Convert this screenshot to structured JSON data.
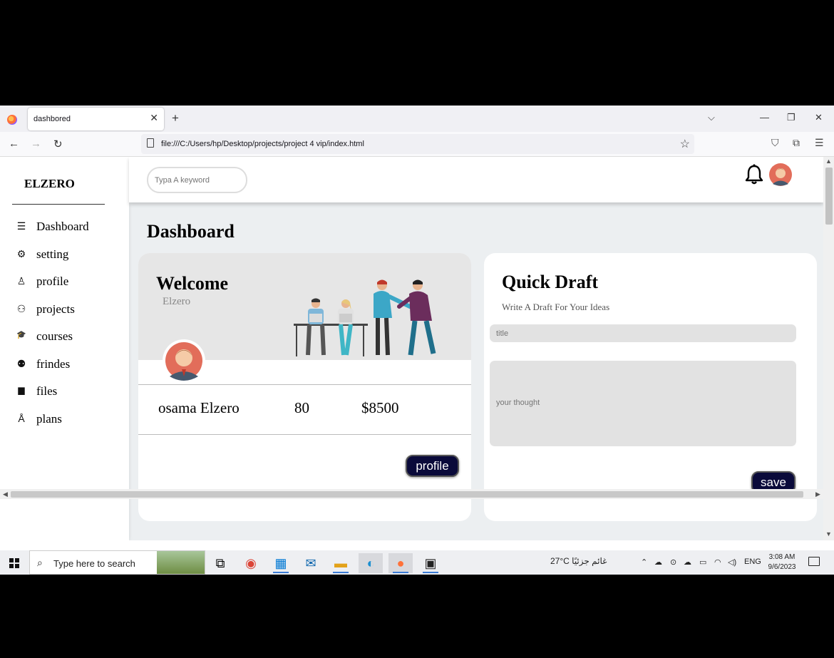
{
  "browser": {
    "tab_title": "dashbored",
    "tab_close": "✕",
    "new_tab": "+",
    "url": "file:///C:/Users/hp/Desktop/projects/project 4 vip/index.html",
    "icons": [
      "firefox-logo",
      "back-arrow-icon",
      "forward-arrow-icon",
      "reload-icon",
      "page-icon",
      "bookmark-star-icon",
      "pocket-icon",
      "extensions-icon",
      "menu-icon",
      "list-tabs-icon",
      "minimize-icon",
      "restore-icon",
      "close-icon"
    ]
  },
  "sidebar": {
    "brand": "ELZERO",
    "items": [
      {
        "label": "Dashboard",
        "icon": "sliders-icon",
        "glyph": "☰"
      },
      {
        "label": "setting",
        "icon": "gear-icon",
        "glyph": "⚙"
      },
      {
        "label": "profile",
        "icon": "user-icon",
        "glyph": "♙"
      },
      {
        "label": "projects",
        "icon": "sitemap-icon",
        "glyph": "⚇"
      },
      {
        "label": "courses",
        "icon": "graduation-cap-icon",
        "glyph": "🎓"
      },
      {
        "label": "frindes",
        "icon": "friends-icon",
        "glyph": "⚉"
      },
      {
        "label": "files",
        "icon": "file-icon",
        "glyph": "▆"
      },
      {
        "label": "plans",
        "icon": "chart-icon",
        "glyph": "Å"
      }
    ]
  },
  "header": {
    "search_placeholder": "Typa A keyword",
    "icons": [
      "bell-icon",
      "avatar"
    ]
  },
  "main": {
    "page_title": "Dashboard",
    "welcome": {
      "title": "Welcome",
      "subtitle": "Elzero",
      "name": "osama Elzero",
      "projects_count": "80",
      "earnings": "$8500",
      "button_label": "profile"
    },
    "draft": {
      "title": "Quick Draft",
      "subtitle": "Write A Draft For Your Ideas",
      "title_placeholder": "title",
      "thought_placeholder": "your thought",
      "button_label": "save"
    }
  },
  "taskbar": {
    "search_text": "Type here to search",
    "weather": "27°C غائم جزئيًا",
    "language": "ENG",
    "time": "3:08 AM",
    "date": "9/6/2023",
    "apps": [
      "task-view-icon",
      "chrome-icon",
      "store-icon",
      "mail-icon",
      "file-explorer-icon",
      "edge-icon",
      "firefox-icon",
      "terminal-icon"
    ]
  }
}
